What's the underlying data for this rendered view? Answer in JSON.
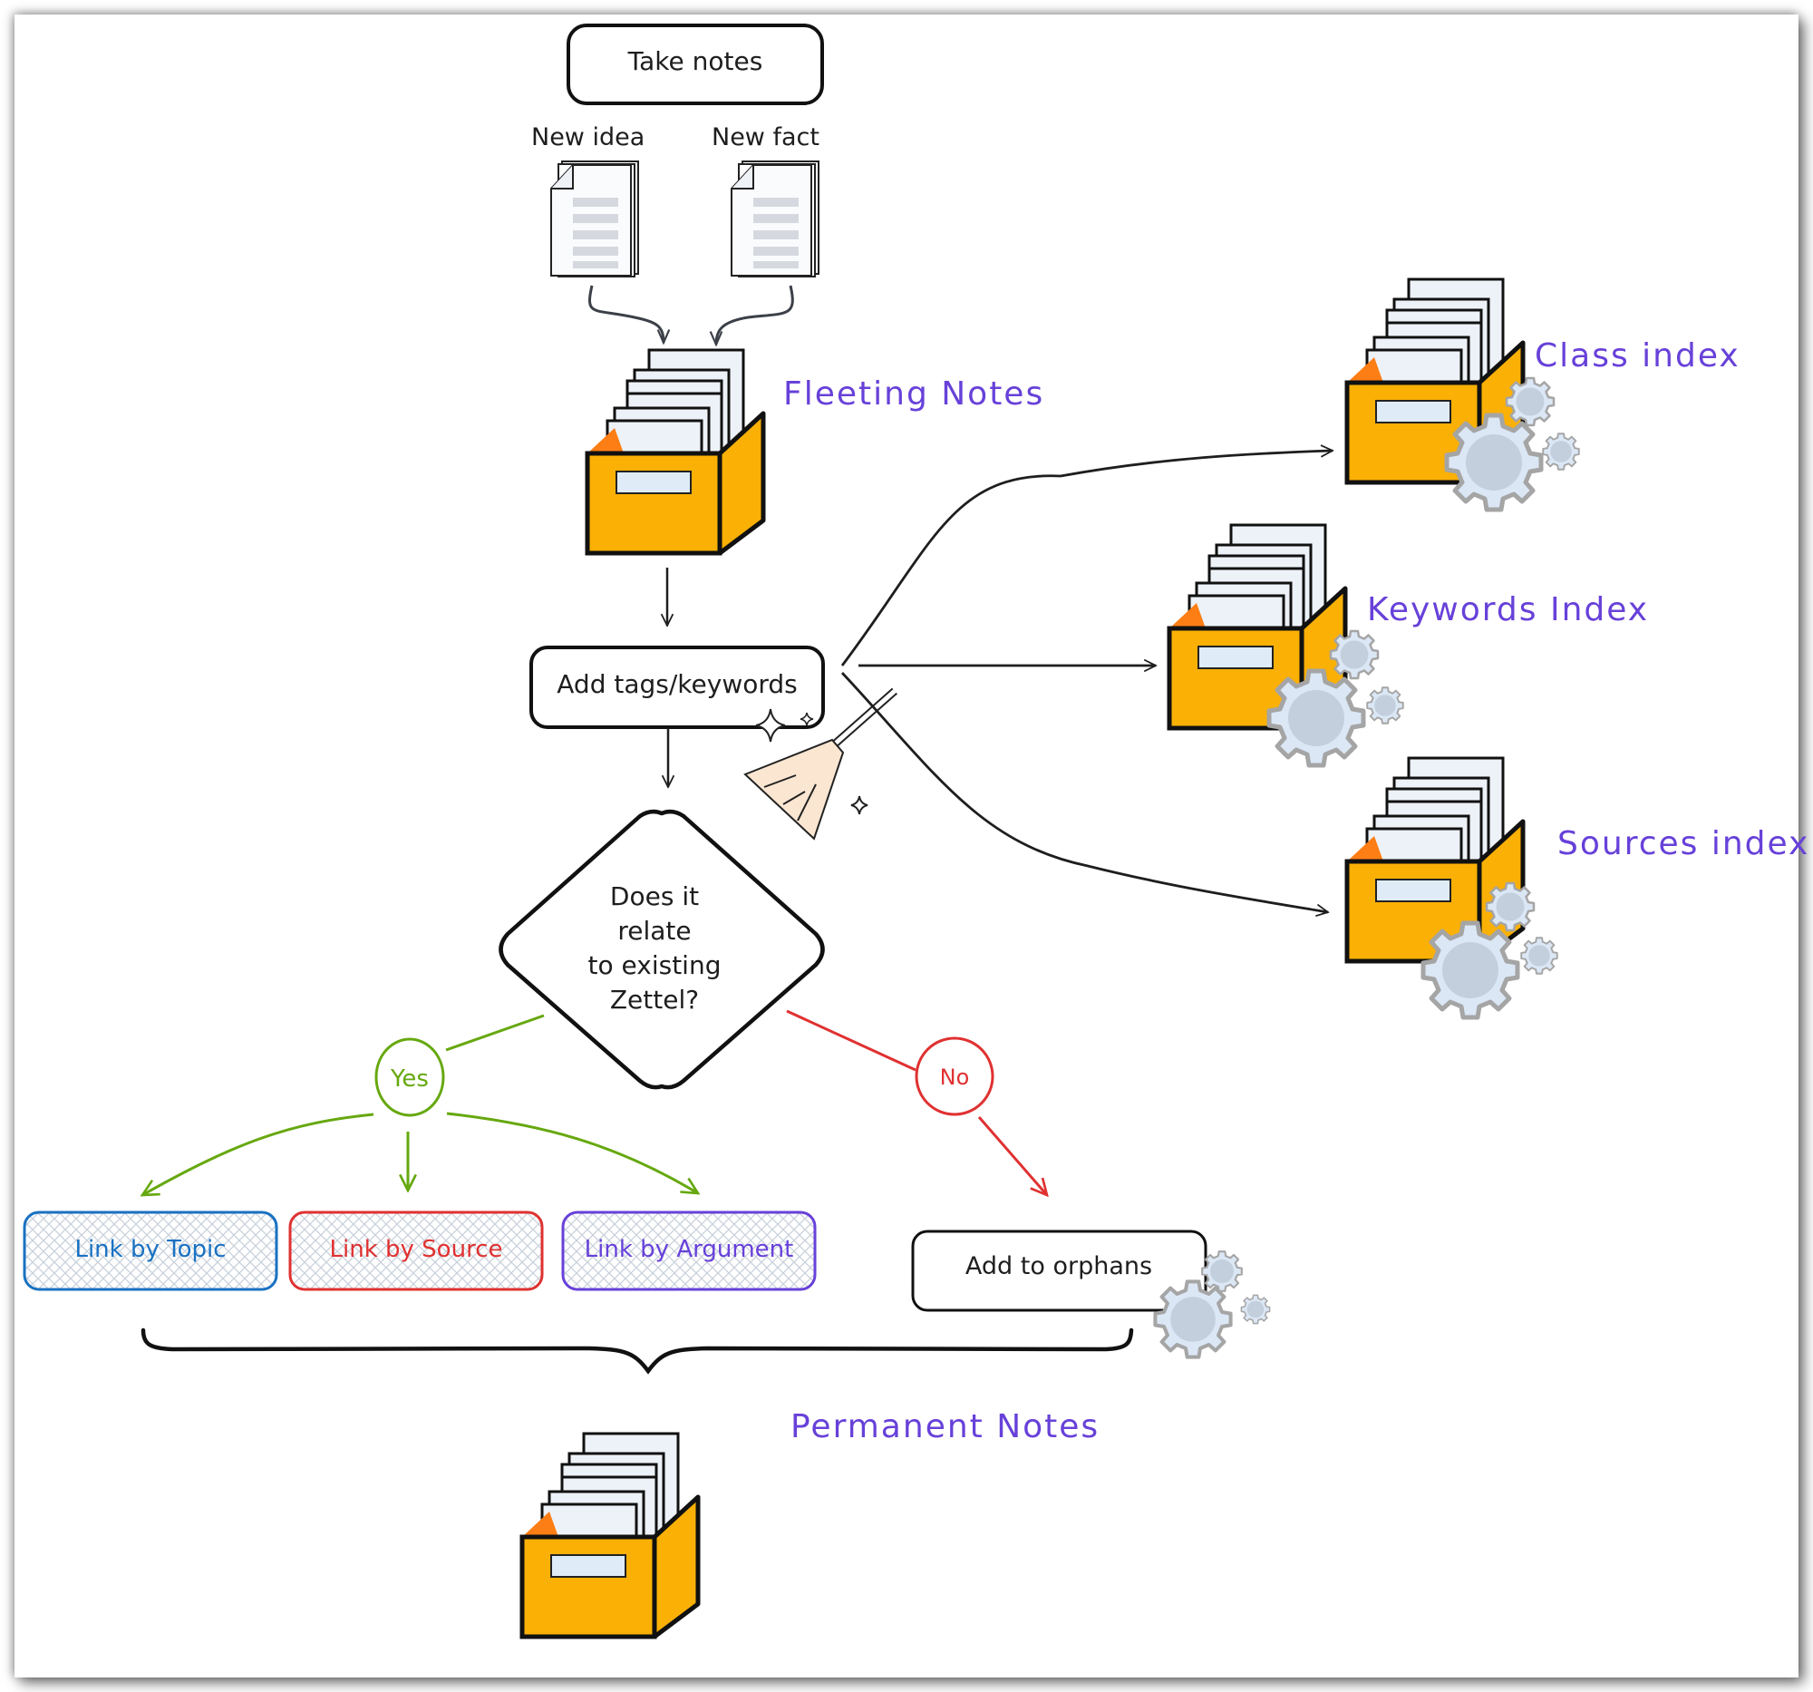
{
  "diagram": {
    "title_node": "Take notes",
    "inputs": [
      {
        "label": "New idea",
        "icon": "document-icon"
      },
      {
        "label": "New fact",
        "icon": "document-icon"
      }
    ],
    "stores": {
      "fleeting": "Fleeting Notes",
      "class_index": "Class index",
      "keywords_index": "Keywords Index",
      "sources_index": "Sources index",
      "permanent": "Permanent Notes"
    },
    "process_node": "Add tags/keywords",
    "decision": {
      "lines": [
        "Does it",
        "relate",
        "to existing",
        "Zettel?"
      ]
    },
    "branches": {
      "yes": "Yes",
      "no": "No"
    },
    "link_nodes": [
      {
        "label": "Link by Topic",
        "color": "#1971c2"
      },
      {
        "label": "Link by Source",
        "color": "#e03131"
      },
      {
        "label": "Link by Argument",
        "color": "#6741d9"
      }
    ],
    "orphan_node": "Add to orphans",
    "colors": {
      "label_purple": "#6741d9",
      "yes_green": "#66a80f",
      "no_red": "#e03131",
      "box_orange": "#fab005",
      "box_inner": "#fd7e14",
      "gear_fill": "#dbe7f5",
      "gear_stroke": "#a5a5a5"
    }
  }
}
